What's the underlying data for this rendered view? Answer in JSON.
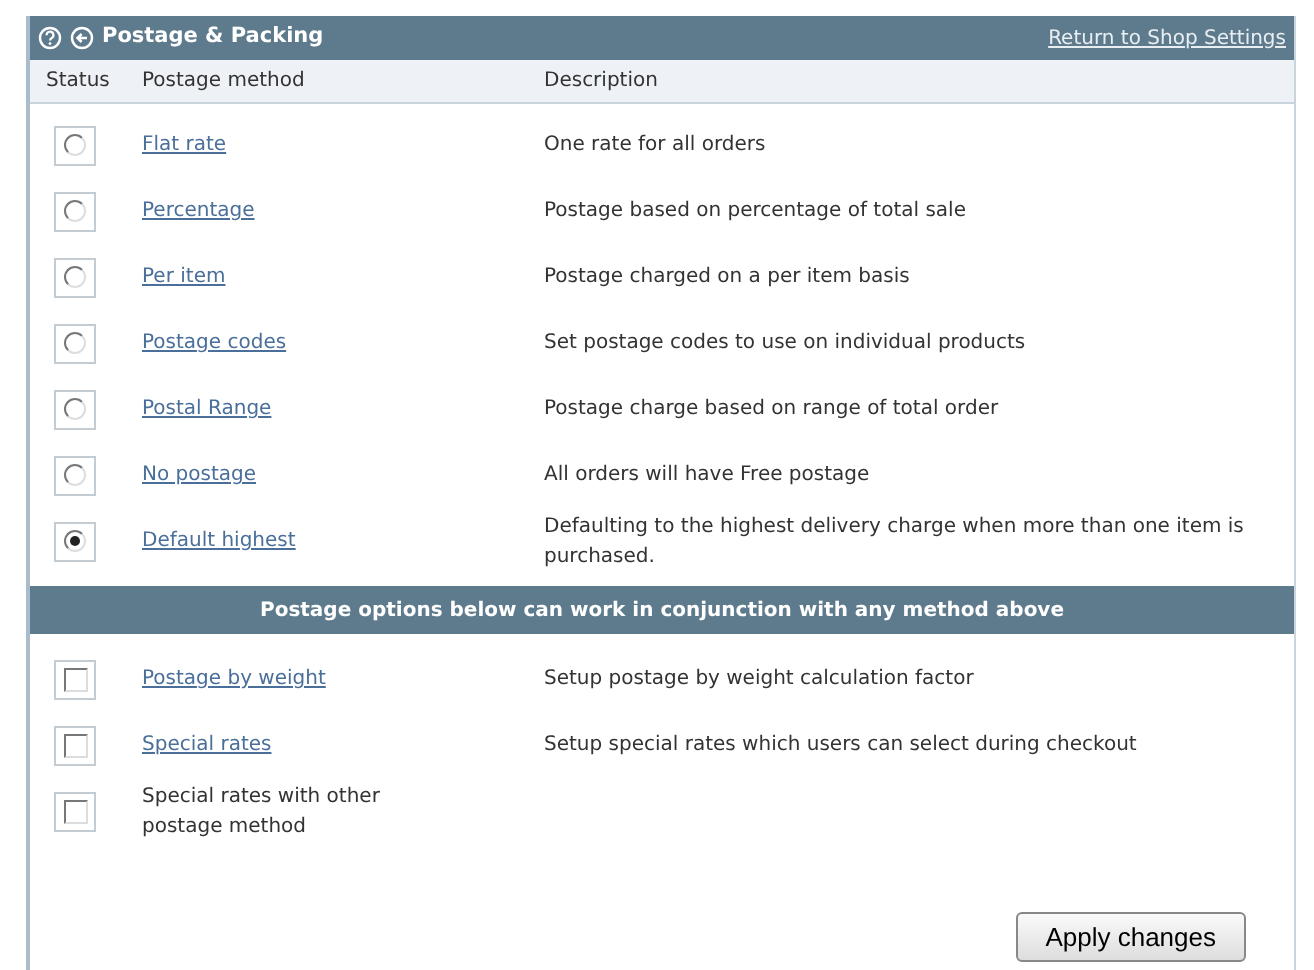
{
  "header": {
    "title": "Postage & Packing",
    "link": "Return to Shop Settings"
  },
  "columns": [
    "Status",
    "Postage method",
    "Description"
  ],
  "methods": [
    {
      "label": "Flat rate",
      "description": "One rate for all orders",
      "selected": false
    },
    {
      "label": "Percentage",
      "description": "Postage based on percentage of total sale",
      "selected": false
    },
    {
      "label": "Per item",
      "description": "Postage charged on a per item basis",
      "selected": false
    },
    {
      "label": "Postage codes",
      "description": "Set postage codes to use on individual products",
      "selected": false
    },
    {
      "label": "Postal Range",
      "description": "Postage charge based on range of total order",
      "selected": false
    },
    {
      "label": "No postage",
      "description": "All orders will have Free postage",
      "selected": false
    },
    {
      "label": "Default highest",
      "description": "Defaulting to the highest delivery charge when more than one item is purchased.",
      "selected": true
    }
  ],
  "section_title": "Postage options below can work in conjunction with any method above",
  "options": [
    {
      "kind": "link",
      "label": "Postage by weight",
      "description": "Setup postage by weight calculation factor",
      "checked": false
    },
    {
      "kind": "link",
      "label": "Special rates",
      "description": "Setup special rates which users can select during checkout",
      "checked": false
    },
    {
      "kind": "text",
      "label": "Special rates with other postage method",
      "checked": false
    }
  ],
  "apply_button": "Apply changes"
}
